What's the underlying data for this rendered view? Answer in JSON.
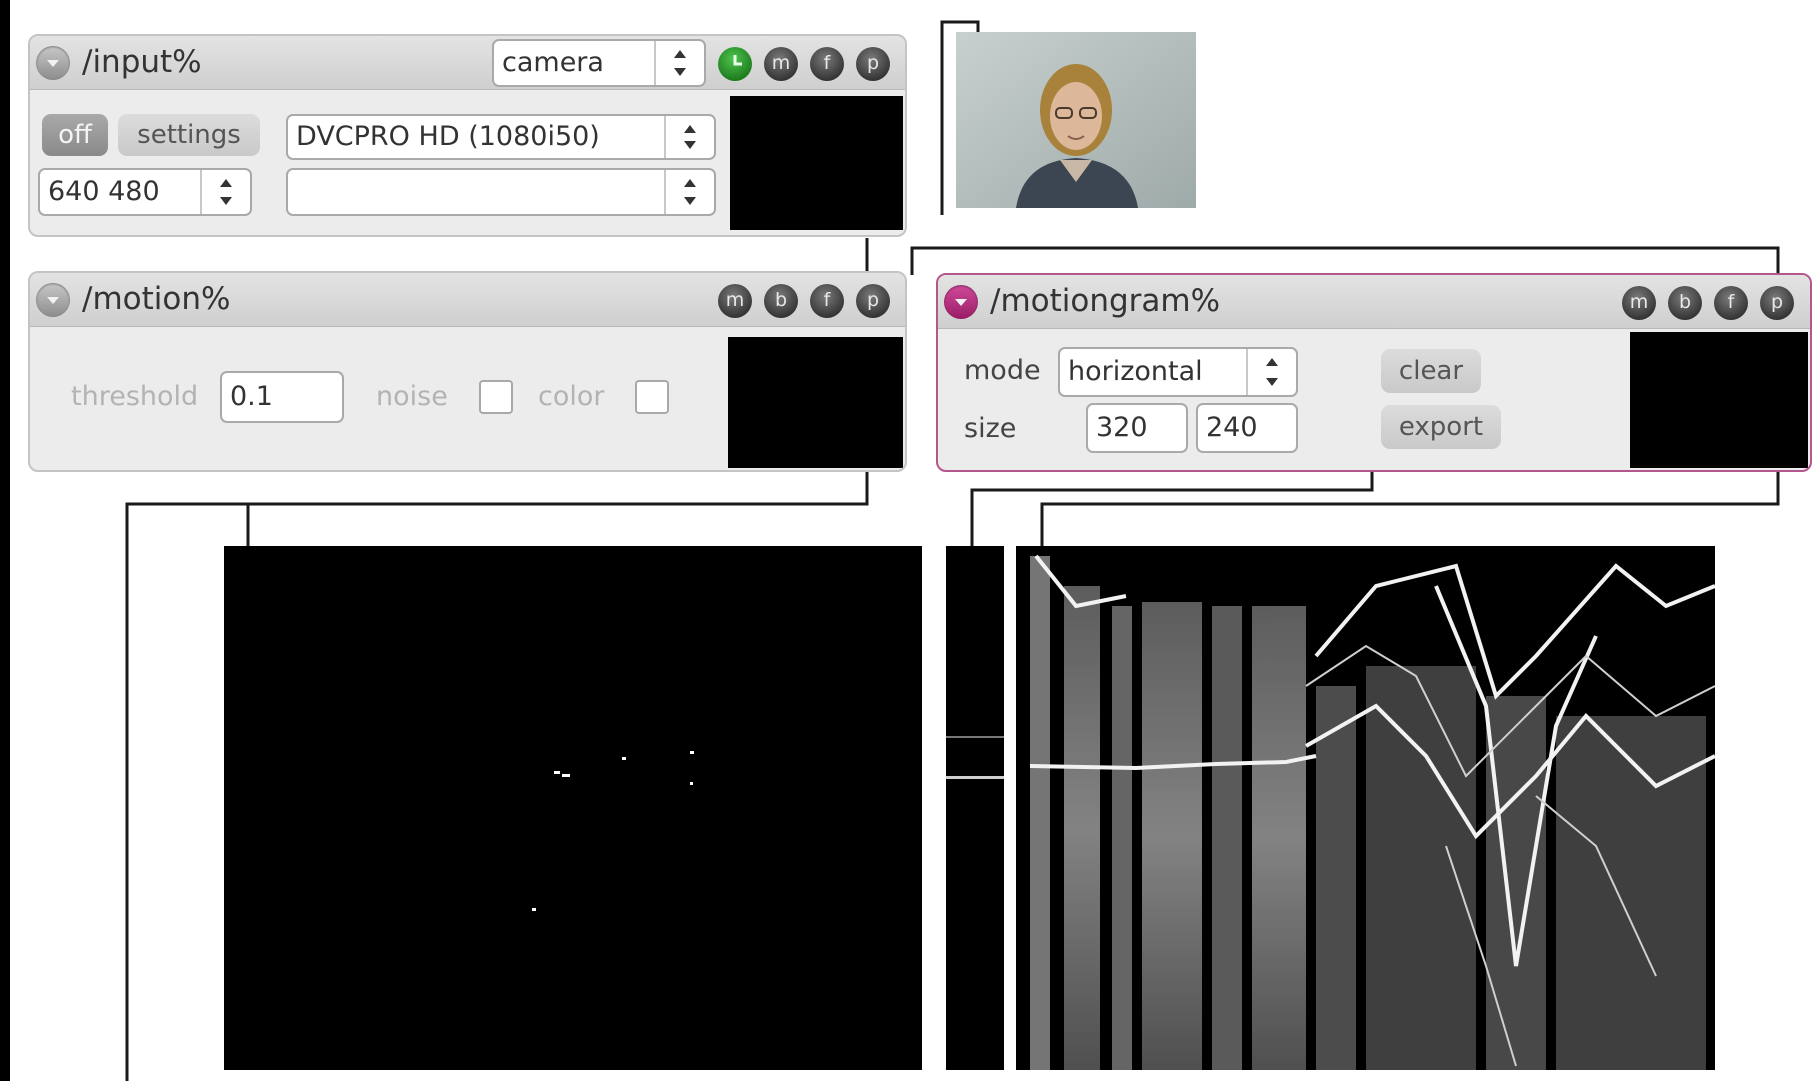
{
  "input_module": {
    "title": "/input%",
    "source_select": "camera",
    "buttons": {
      "m": "m",
      "f": "f",
      "p": "p"
    },
    "off_label": "off",
    "settings_label": "settings",
    "format_select": "DVCPRO HD (1080i50)",
    "resolution_select": "640 480",
    "device_select": ""
  },
  "motion_module": {
    "title": "/motion%",
    "buttons": {
      "m": "m",
      "b": "b",
      "f": "f",
      "p": "p"
    },
    "threshold_label": "threshold",
    "threshold_value": "0.1",
    "noise_label": "noise",
    "color_label": "color"
  },
  "motiongram_module": {
    "title": "/motiongram%",
    "buttons": {
      "m": "m",
      "b": "b",
      "f": "f",
      "p": "p"
    },
    "mode_label": "mode",
    "mode_select": "horizontal",
    "size_label": "size",
    "size_width": "320",
    "size_height": "240",
    "clear_label": "clear",
    "export_label": "export"
  },
  "colors": {
    "canvas": "#ffffff",
    "panel": "#ececec",
    "accent_pink": "#b5578f",
    "active_green": "#2f9e2f",
    "cable": "#1a1a1a"
  }
}
